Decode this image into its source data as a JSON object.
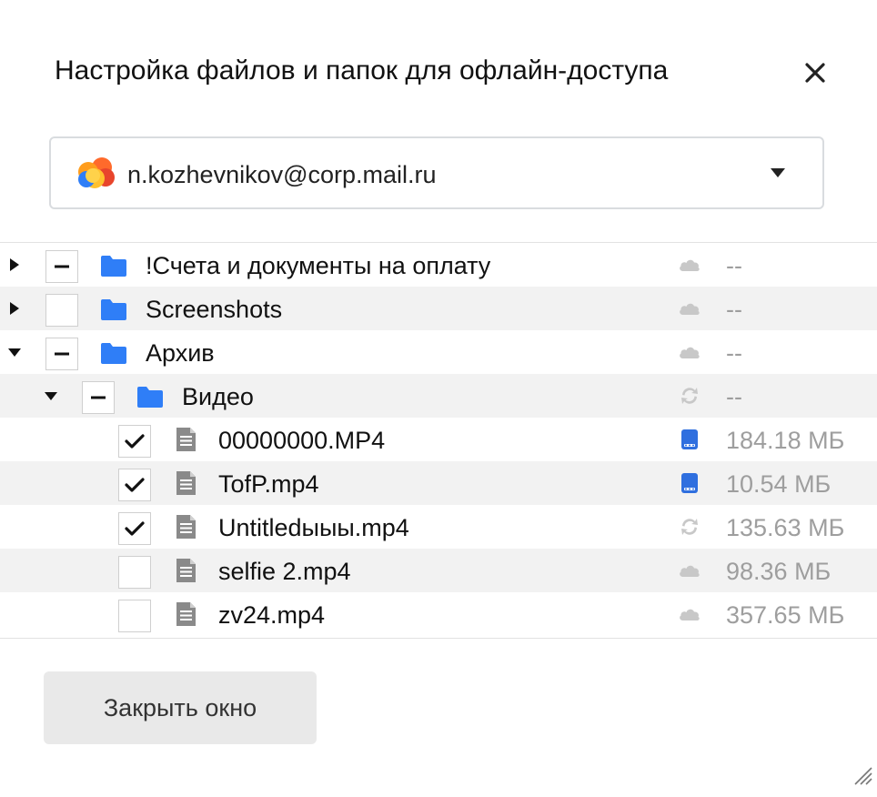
{
  "dialog": {
    "title": "Настройка файлов и папок для офлайн-доступа",
    "close_icon": "close-icon"
  },
  "account": {
    "email": "n.kozhevnikov@corp.mail.ru",
    "logo_icon": "mail-cloud-logo",
    "dropdown_icon": "caret-down-icon"
  },
  "tree": {
    "rows": [
      {
        "name": "!Счета и документы на оплату",
        "type": "folder",
        "level": 0,
        "expand": "collapsed",
        "check": "partial",
        "status": "cloud",
        "size": "--"
      },
      {
        "name": "Screenshots",
        "type": "folder",
        "level": 0,
        "expand": "collapsed",
        "check": "unchecked",
        "status": "cloud",
        "size": "--"
      },
      {
        "name": "Архив",
        "type": "folder",
        "level": 0,
        "expand": "expanded",
        "check": "partial",
        "status": "cloud",
        "size": "--"
      },
      {
        "name": "Видео",
        "type": "folder",
        "level": 1,
        "expand": "expanded",
        "check": "partial",
        "status": "sync",
        "size": "--"
      },
      {
        "name": "00000000.MP4",
        "type": "file",
        "level": 2,
        "expand": "none",
        "check": "checked",
        "status": "device",
        "size": "184.18 МБ"
      },
      {
        "name": "TofP.mp4",
        "type": "file",
        "level": 2,
        "expand": "none",
        "check": "checked",
        "status": "device",
        "size": "10.54 МБ"
      },
      {
        "name": "Untitledыыы.mp4",
        "type": "file",
        "level": 2,
        "expand": "none",
        "check": "checked",
        "status": "sync",
        "size": "135.63 МБ"
      },
      {
        "name": "selfie 2.mp4",
        "type": "file",
        "level": 2,
        "expand": "none",
        "check": "unchecked",
        "status": "cloud",
        "size": "98.36 МБ"
      },
      {
        "name": "zv24.mp4",
        "type": "file",
        "level": 2,
        "expand": "none",
        "check": "unchecked",
        "status": "cloud",
        "size": "357.65 МБ"
      }
    ]
  },
  "footer": {
    "close_label": "Закрыть окно"
  },
  "colors": {
    "folder": "#2f7ef7",
    "device": "#2f6fdf",
    "status_gray": "#c8c8c8",
    "file_icon": "#8a8a8a",
    "size_text": "#9e9e9e",
    "row_alt": "#f2f2f2"
  }
}
